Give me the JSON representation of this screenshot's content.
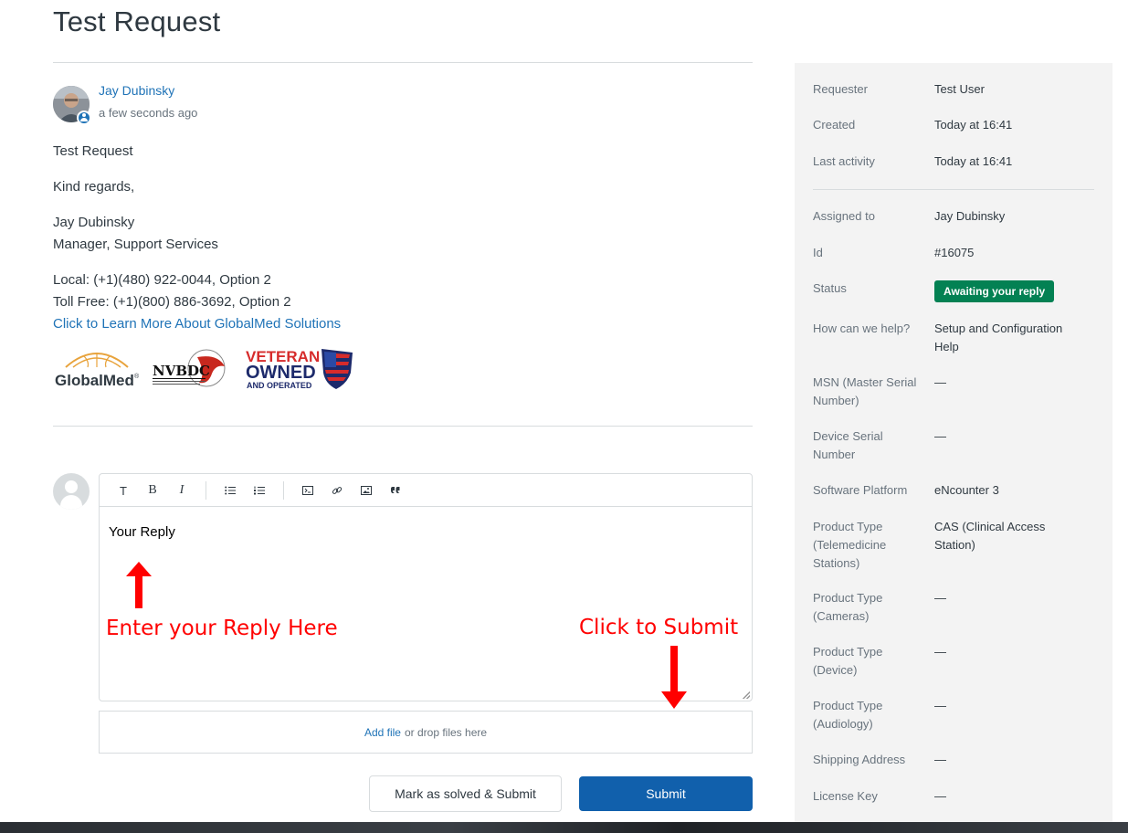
{
  "page": {
    "title": "Test Request"
  },
  "comment": {
    "author": "Jay Dubinsky",
    "time": "a few seconds ago",
    "greeting": "Test Request",
    "regards": "Kind regards,",
    "signature_name": "Jay Dubinsky",
    "signature_title": "Manager, Support Services",
    "local": "Local: (+1)(480) 922-0044, Option 2",
    "tollfree": "Toll Free: (+1)(800) 886-3692, Option 2",
    "learn_more_link": "Click to Learn More About GlobalMed Solutions",
    "logos": {
      "globalmed": "GlobalMed",
      "globalmed_mark": "®",
      "nvbdc": "NVBDC",
      "veteran_line1": "VETERAN",
      "veteran_line2": "OWNED",
      "veteran_line3": "AND OPERATED"
    }
  },
  "editor": {
    "toolbar": {
      "text": "T",
      "bold": "B",
      "italic": "I"
    },
    "placeholder": "Your Reply",
    "annotation_reply": "Enter your Reply Here",
    "annotation_submit": "Click to Submit"
  },
  "attachments": {
    "add_file": "Add file",
    "drop_text": "or drop files here"
  },
  "actions": {
    "mark_solved": "Mark as solved & Submit",
    "submit": "Submit"
  },
  "sidebar": {
    "requester": {
      "label": "Requester",
      "value": "Test User"
    },
    "created": {
      "label": "Created",
      "value": "Today at 16:41"
    },
    "last_activity": {
      "label": "Last activity",
      "value": "Today at 16:41"
    },
    "assigned_to": {
      "label": "Assigned to",
      "value": "Jay Dubinsky"
    },
    "id": {
      "label": "Id",
      "value": "#16075"
    },
    "status": {
      "label": "Status",
      "value": "Awaiting your reply"
    },
    "help": {
      "label": "How can we help?",
      "value": "Setup and Configuration Help"
    },
    "msn": {
      "label": "MSN (Master Serial Number)",
      "value": "—"
    },
    "device_serial": {
      "label": "Device Serial Number",
      "value": "—"
    },
    "software_platform": {
      "label": "Software Platform",
      "value": "eNcounter 3"
    },
    "product_telemedicine": {
      "label": "Product Type (Telemedicine Stations)",
      "value": "CAS (Clinical Access Station)"
    },
    "product_cameras": {
      "label": "Product Type (Cameras)",
      "value": "—"
    },
    "product_device": {
      "label": "Product Type (Device)",
      "value": "—"
    },
    "product_audiology": {
      "label": "Product Type (Audiology)",
      "value": "—"
    },
    "shipping_address": {
      "label": "Shipping Address",
      "value": "—"
    },
    "license_key": {
      "label": "License Key",
      "value": "—"
    }
  },
  "colors": {
    "link": "#1f73b7",
    "submit": "#1160ac",
    "status_badge": "#038153",
    "annotation": "#ff0000"
  }
}
